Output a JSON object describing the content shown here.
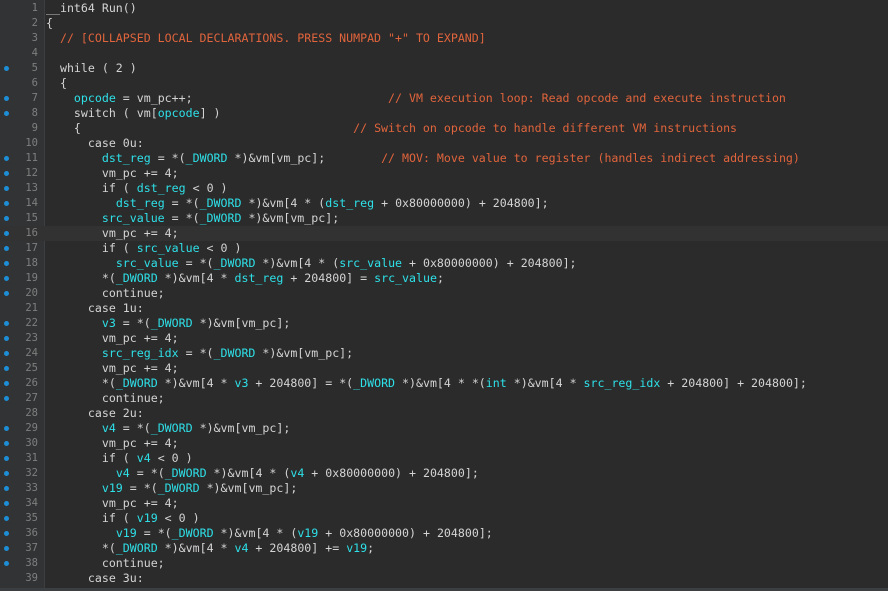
{
  "editor": {
    "colors": {
      "background": "#2b2b2b",
      "identifier": "#2ee0e8",
      "comment": "#e0643c",
      "text": "#d4d4d4",
      "breakpoint": "#1e8fd6",
      "line_number": "#7f7f7f"
    },
    "lines": [
      {
        "n": "1",
        "bp": false,
        "tokens": [
          [
            "p",
            "__int64 Run()"
          ]
        ]
      },
      {
        "n": "2",
        "bp": false,
        "tokens": [
          [
            "p",
            "{"
          ]
        ]
      },
      {
        "n": "3",
        "bp": false,
        "tokens": [
          [
            "c",
            "  // [COLLAPSED LOCAL DECLARATIONS. PRESS NUMPAD \"+\" TO EXPAND]"
          ]
        ]
      },
      {
        "n": "4",
        "bp": false,
        "tokens": []
      },
      {
        "n": "5",
        "bp": true,
        "tokens": [
          [
            "p",
            "  while ( 2 )"
          ]
        ]
      },
      {
        "n": "6",
        "bp": false,
        "tokens": [
          [
            "p",
            "  {"
          ]
        ]
      },
      {
        "n": "7",
        "bp": true,
        "tokens": [
          [
            "p",
            "    "
          ],
          [
            "v",
            "opcode"
          ],
          [
            "p",
            " = vm_pc++;                            "
          ],
          [
            "c",
            "// VM execution loop: Read opcode and execute instruction"
          ]
        ]
      },
      {
        "n": "8",
        "bp": true,
        "tokens": [
          [
            "p",
            "    switch ( vm["
          ],
          [
            "v",
            "opcode"
          ],
          [
            "p",
            "] )"
          ]
        ]
      },
      {
        "n": "9",
        "bp": false,
        "tokens": [
          [
            "p",
            "    {                                       "
          ],
          [
            "c",
            "// Switch on opcode to handle different VM instructions"
          ]
        ]
      },
      {
        "n": "10",
        "bp": false,
        "tokens": [
          [
            "p",
            "      case 0u:"
          ]
        ]
      },
      {
        "n": "11",
        "bp": true,
        "tokens": [
          [
            "p",
            "        "
          ],
          [
            "v",
            "dst_reg"
          ],
          [
            "p",
            " = *("
          ],
          [
            "t",
            "_DWORD"
          ],
          [
            "p",
            " *)&vm[vm_pc];        "
          ],
          [
            "c",
            "// MOV: Move value to register (handles indirect addressing)"
          ]
        ]
      },
      {
        "n": "12",
        "bp": true,
        "tokens": [
          [
            "p",
            "        vm_pc += 4;"
          ]
        ]
      },
      {
        "n": "13",
        "bp": true,
        "tokens": [
          [
            "p",
            "        if ( "
          ],
          [
            "v",
            "dst_reg"
          ],
          [
            "p",
            " < 0 )"
          ]
        ]
      },
      {
        "n": "14",
        "bp": true,
        "tokens": [
          [
            "p",
            "          "
          ],
          [
            "v",
            "dst_reg"
          ],
          [
            "p",
            " = *("
          ],
          [
            "t",
            "_DWORD"
          ],
          [
            "p",
            " *)&vm[4 * ("
          ],
          [
            "v",
            "dst_reg"
          ],
          [
            "p",
            " + 0x80000000) + 204800];"
          ]
        ]
      },
      {
        "n": "15",
        "bp": true,
        "tokens": [
          [
            "p",
            "        "
          ],
          [
            "v",
            "src_value"
          ],
          [
            "p",
            " = *("
          ],
          [
            "t",
            "_DWORD"
          ],
          [
            "p",
            " *)&vm[vm_pc];"
          ]
        ]
      },
      {
        "n": "16",
        "bp": true,
        "cur": true,
        "tokens": [
          [
            "p",
            "        vm_pc += 4;"
          ]
        ]
      },
      {
        "n": "17",
        "bp": true,
        "tokens": [
          [
            "p",
            "        if ( "
          ],
          [
            "v",
            "src_value"
          ],
          [
            "p",
            " < 0 )"
          ]
        ]
      },
      {
        "n": "18",
        "bp": true,
        "tokens": [
          [
            "p",
            "          "
          ],
          [
            "v",
            "src_value"
          ],
          [
            "p",
            " = *("
          ],
          [
            "t",
            "_DWORD"
          ],
          [
            "p",
            " *)&vm[4 * ("
          ],
          [
            "v",
            "src_value"
          ],
          [
            "p",
            " + 0x80000000) + 204800];"
          ]
        ]
      },
      {
        "n": "19",
        "bp": true,
        "tokens": [
          [
            "p",
            "        *("
          ],
          [
            "t",
            "_DWORD"
          ],
          [
            "p",
            " *)&vm[4 * "
          ],
          [
            "v",
            "dst_reg"
          ],
          [
            "p",
            " + 204800] = "
          ],
          [
            "v",
            "src_value"
          ],
          [
            "p",
            ";"
          ]
        ]
      },
      {
        "n": "20",
        "bp": true,
        "tokens": [
          [
            "p",
            "        continue;"
          ]
        ]
      },
      {
        "n": "21",
        "bp": false,
        "tokens": [
          [
            "p",
            "      case 1u:"
          ]
        ]
      },
      {
        "n": "22",
        "bp": true,
        "tokens": [
          [
            "p",
            "        "
          ],
          [
            "v",
            "v3"
          ],
          [
            "p",
            " = *("
          ],
          [
            "t",
            "_DWORD"
          ],
          [
            "p",
            " *)&vm[vm_pc];"
          ]
        ]
      },
      {
        "n": "23",
        "bp": true,
        "tokens": [
          [
            "p",
            "        vm_pc += 4;"
          ]
        ]
      },
      {
        "n": "24",
        "bp": true,
        "tokens": [
          [
            "p",
            "        "
          ],
          [
            "v",
            "src_reg_idx"
          ],
          [
            "p",
            " = *("
          ],
          [
            "t",
            "_DWORD"
          ],
          [
            "p",
            " *)&vm[vm_pc];"
          ]
        ]
      },
      {
        "n": "25",
        "bp": true,
        "tokens": [
          [
            "p",
            "        vm_pc += 4;"
          ]
        ]
      },
      {
        "n": "26",
        "bp": true,
        "tokens": [
          [
            "p",
            "        *("
          ],
          [
            "t",
            "_DWORD"
          ],
          [
            "p",
            " *)&vm[4 * "
          ],
          [
            "v",
            "v3"
          ],
          [
            "p",
            " + 204800] = *("
          ],
          [
            "t",
            "_DWORD"
          ],
          [
            "p",
            " *)&vm[4 * *("
          ],
          [
            "t",
            "int"
          ],
          [
            "p",
            " *)&vm[4 * "
          ],
          [
            "v",
            "src_reg_idx"
          ],
          [
            "p",
            " + 204800] + 204800];"
          ]
        ]
      },
      {
        "n": "27",
        "bp": true,
        "tokens": [
          [
            "p",
            "        continue;"
          ]
        ]
      },
      {
        "n": "28",
        "bp": false,
        "tokens": [
          [
            "p",
            "      case 2u:"
          ]
        ]
      },
      {
        "n": "29",
        "bp": true,
        "tokens": [
          [
            "p",
            "        "
          ],
          [
            "v",
            "v4"
          ],
          [
            "p",
            " = *("
          ],
          [
            "t",
            "_DWORD"
          ],
          [
            "p",
            " *)&vm[vm_pc];"
          ]
        ]
      },
      {
        "n": "30",
        "bp": true,
        "tokens": [
          [
            "p",
            "        vm_pc += 4;"
          ]
        ]
      },
      {
        "n": "31",
        "bp": true,
        "tokens": [
          [
            "p",
            "        if ( "
          ],
          [
            "v",
            "v4"
          ],
          [
            "p",
            " < 0 )"
          ]
        ]
      },
      {
        "n": "32",
        "bp": true,
        "tokens": [
          [
            "p",
            "          "
          ],
          [
            "v",
            "v4"
          ],
          [
            "p",
            " = *("
          ],
          [
            "t",
            "_DWORD"
          ],
          [
            "p",
            " *)&vm[4 * ("
          ],
          [
            "v",
            "v4"
          ],
          [
            "p",
            " + 0x80000000) + 204800];"
          ]
        ]
      },
      {
        "n": "33",
        "bp": true,
        "tokens": [
          [
            "p",
            "        "
          ],
          [
            "v",
            "v19"
          ],
          [
            "p",
            " = *("
          ],
          [
            "t",
            "_DWORD"
          ],
          [
            "p",
            " *)&vm[vm_pc];"
          ]
        ]
      },
      {
        "n": "34",
        "bp": true,
        "tokens": [
          [
            "p",
            "        vm_pc += 4;"
          ]
        ]
      },
      {
        "n": "35",
        "bp": true,
        "tokens": [
          [
            "p",
            "        if ( "
          ],
          [
            "v",
            "v19"
          ],
          [
            "p",
            " < 0 )"
          ]
        ]
      },
      {
        "n": "36",
        "bp": true,
        "tokens": [
          [
            "p",
            "          "
          ],
          [
            "v",
            "v19"
          ],
          [
            "p",
            " = *("
          ],
          [
            "t",
            "_DWORD"
          ],
          [
            "p",
            " *)&vm[4 * ("
          ],
          [
            "v",
            "v19"
          ],
          [
            "p",
            " + 0x80000000) + 204800];"
          ]
        ]
      },
      {
        "n": "37",
        "bp": true,
        "tokens": [
          [
            "p",
            "        *("
          ],
          [
            "t",
            "_DWORD"
          ],
          [
            "p",
            " *)&vm[4 * "
          ],
          [
            "v",
            "v4"
          ],
          [
            "p",
            " + 204800] += "
          ],
          [
            "v",
            "v19"
          ],
          [
            "p",
            ";"
          ]
        ]
      },
      {
        "n": "38",
        "bp": true,
        "tokens": [
          [
            "p",
            "        continue;"
          ]
        ]
      },
      {
        "n": "39",
        "bp": false,
        "tokens": [
          [
            "p",
            "      case 3u:"
          ]
        ]
      }
    ]
  }
}
